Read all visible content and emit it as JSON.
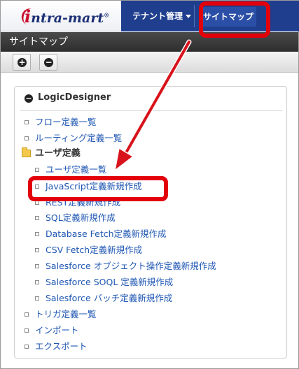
{
  "header": {
    "logo_prefix": "i",
    "logo_text": "ntra-mart",
    "logo_mark": "®",
    "nav": {
      "tenant_label": "テナント管理",
      "sitemap_label": "サイトマップ"
    }
  },
  "page": {
    "title": "サイトマップ"
  },
  "toolbar": {
    "expand_icon": "plus-circle-icon",
    "collapse_icon": "minus-circle-icon"
  },
  "tree": {
    "root_label": "LogicDesigner",
    "items": [
      {
        "label": "フロー定義一覧"
      },
      {
        "label": "ルーティング定義一覧"
      }
    ],
    "folder_label": "ユーザ定義",
    "folder_items": [
      {
        "label": "ユーザ定義一覧"
      },
      {
        "label": "JavaScript定義新規作成"
      },
      {
        "label": "REST定義新規作成"
      },
      {
        "label": "SQL定義新規作成"
      },
      {
        "label": "Database Fetch定義新規作成"
      },
      {
        "label": "CSV Fetch定義新規作成"
      },
      {
        "label": "Salesforce オブジェクト操作定義新規作成"
      },
      {
        "label": "Salesforce SOQL 定義新規作成"
      },
      {
        "label": "Salesforce バッチ定義新規作成"
      }
    ],
    "bottom_items": [
      {
        "label": "トリガ定義一覧"
      },
      {
        "label": "インポート"
      },
      {
        "label": "エクスポート"
      }
    ]
  },
  "colors": {
    "nav_bg": "#1f3f8e",
    "link": "#1f57b3",
    "highlight": "#e3000b"
  }
}
